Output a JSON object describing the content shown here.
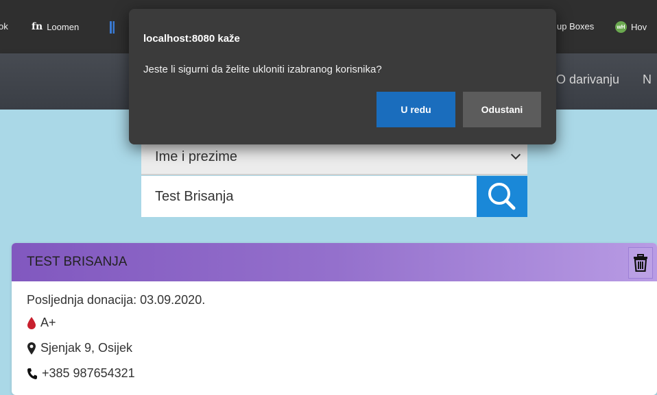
{
  "browser": {
    "bookmarks": [
      {
        "label": "ok",
        "icon": "facebook-favicon"
      },
      {
        "label": "Loomen",
        "icon": "moodle-fm-icon"
      },
      {
        "label": "",
        "icon": "wave-icon"
      },
      {
        "label": "up Boxes",
        "icon": ""
      },
      {
        "label": "Hov",
        "icon": "wh-icon"
      }
    ]
  },
  "navbar": {
    "items": [
      "O darivanju",
      "N"
    ]
  },
  "filter": {
    "selected": "Ime i prezime",
    "search_value": "Test Brisanja"
  },
  "result_card": {
    "name": "TEST BRISANJA",
    "last_donation": "Posljednja donacija: 03.09.2020.",
    "blood_type": "A+",
    "address": "Sjenjak 9, Osijek",
    "phone": "+385 987654321"
  },
  "dialog": {
    "title": "localhost:8080 kaže",
    "message": "Jeste li sigurni da želite ukloniti izabranog korisnika?",
    "ok_label": "U redu",
    "cancel_label": "Odustani"
  },
  "colors": {
    "accent": "#1a6dbd",
    "card_header": "#8158bf",
    "background": "#aad8e7",
    "blood_drop": "#c8202e"
  }
}
